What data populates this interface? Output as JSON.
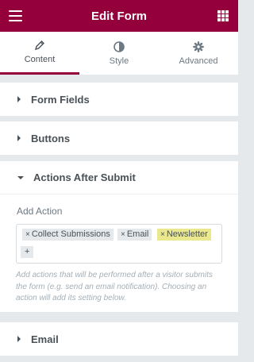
{
  "header": {
    "title": "Edit Form",
    "bg_color": "#93003c",
    "menu_icon": "hamburger-icon",
    "grid_icon": "apps-grid-icon"
  },
  "tabs": [
    {
      "label": "Content",
      "icon": "pencil-icon",
      "active": true
    },
    {
      "label": "Style",
      "icon": "contrast-icon",
      "active": false
    },
    {
      "label": "Advanced",
      "icon": "gear-icon",
      "active": false
    }
  ],
  "sections": {
    "form_fields": "Form Fields",
    "buttons": "Buttons",
    "actions_after_submit": "Actions After Submit",
    "email": "Email"
  },
  "actions": {
    "add_action_label": "Add Action",
    "selected": [
      "Collect Submissions",
      "Email",
      "Newsletter"
    ],
    "add_button": "+",
    "remove_glyph": "×",
    "highlight_color": "#f6f50a",
    "hint": "Add actions that will be performed after a visitor submits the form (e.g. send an email notification). Choosing an action will add its setting below."
  }
}
